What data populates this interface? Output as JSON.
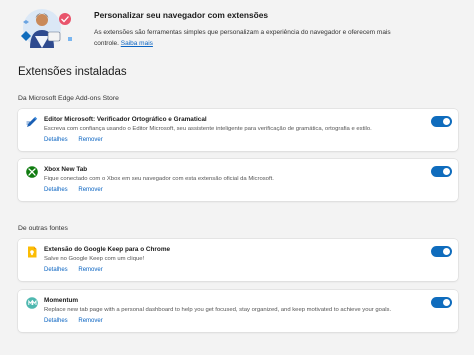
{
  "banner": {
    "title": "Personalizar seu navegador com extensões",
    "description": "As extensões são ferramentas simples que personalizam a experiência do navegador e oferecem mais controle.",
    "link": "Saiba mais"
  },
  "installed_heading": "Extensões instaladas",
  "groups": [
    {
      "heading": "Da Microsoft Edge Add-ons Store",
      "extensions": [
        {
          "name": "Editor Microsoft: Verificador Ortográfico e Gramatical",
          "description": "Escreva com confiança usando o Editor Microsoft, seu assistente inteligente para verificação de gramática, ortografia e estilo.",
          "details": "Detalhes",
          "remove": "Remover",
          "enabled": true,
          "icon": "editor-pen-icon"
        },
        {
          "name": "Xbox New Tab",
          "description": "Fique conectado com o Xbox em seu navegador com esta extensão oficial da Microsoft.",
          "details": "Detalhes",
          "remove": "Remover",
          "enabled": true,
          "icon": "xbox-icon"
        }
      ]
    },
    {
      "heading": "De outras fontes",
      "extensions": [
        {
          "name": "Extensão do Google Keep para o Chrome",
          "description": "Salve no Google Keep com um clique!",
          "details": "Detalhes",
          "remove": "Remover",
          "enabled": true,
          "icon": "google-keep-icon"
        },
        {
          "name": "Momentum",
          "description": "Replace new tab page with a personal dashboard to help you get focused, stay organized, and keep motivated to achieve your goals.",
          "details": "Detalhes",
          "remove": "Remover",
          "enabled": true,
          "icon": "momentum-icon"
        }
      ]
    }
  ],
  "colors": {
    "accent": "#0f6cbd",
    "link": "#0a64c2",
    "background": "#f3f3f3"
  }
}
